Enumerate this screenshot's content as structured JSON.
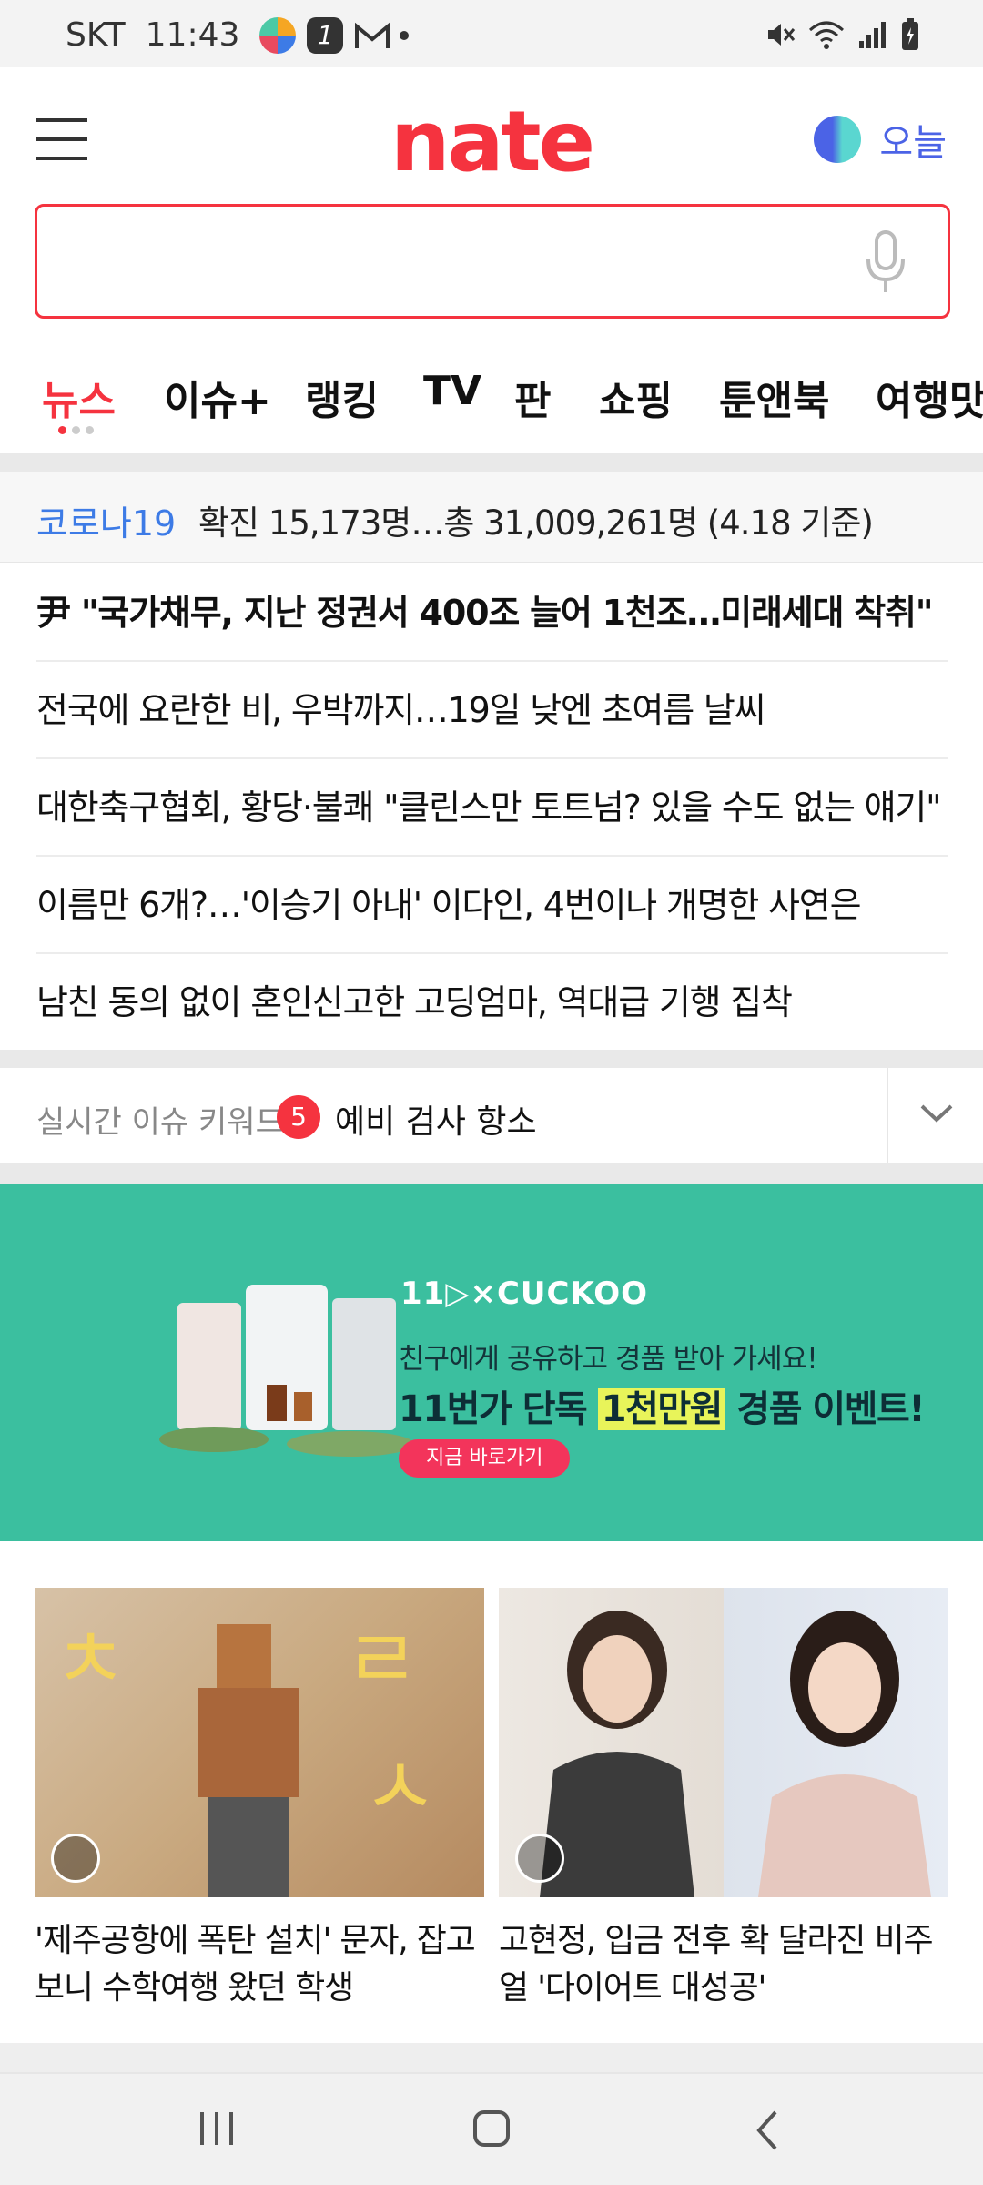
{
  "status_bar": {
    "carrier": "SKT",
    "time": "11:43"
  },
  "header": {
    "logo": "nate",
    "today_label": "오늘"
  },
  "search": {
    "value": "",
    "placeholder": ""
  },
  "tabs": [
    {
      "label": "뉴스"
    },
    {
      "label": "이슈+"
    },
    {
      "label": "랭킹"
    },
    {
      "label": "TV"
    },
    {
      "label": "판"
    },
    {
      "label": "쇼핑"
    },
    {
      "label": "툰앤북"
    },
    {
      "label": "여행맛"
    }
  ],
  "covid": {
    "label": "코로나19",
    "text": "확진 15,173명…총 31,009,261명 (4.18 기준)"
  },
  "headlines": [
    "尹 \"국가채무, 지난 정권서 400조 늘어 1천조…미래세대 착취\"",
    "전국에 요란한 비, 우박까지…19일 낮엔 초여름 날씨",
    "대한축구협회, 황당·불쾌 \"클린스만 토트넘? 있을 수도 없는 얘기\"",
    "이름만 6개?…'이승기 아내' 이다인, 4번이나 개명한 사연은",
    "남친 동의 없이 혼인신고한 고딩엄마, 역대급 기행 집착"
  ],
  "keyword": {
    "label": "실시간 이슈 키워드",
    "rank": "5",
    "text": "예비 검사 항소"
  },
  "ad": {
    "brand": "11▷×CUCKOO",
    "line1": "친구에게 공유하고 경품 받아 가세요!",
    "line2_pre": "11번가 단독",
    "line2_highlight": "1천만원",
    "line2_post": "경품 이벤트!",
    "cta": "지금 바로가기",
    "bg_color": "#3bbf9f"
  },
  "cards": [
    {
      "title": "'제주공항에 폭탄 설치' 문자, 잡고보니 수학여행 왔던 학생"
    },
    {
      "title": "고현정, 입금 전후 확 달라진 비주얼 '다이어트 대성공'"
    }
  ],
  "colors": {
    "accent": "#f5333f",
    "link_blue": "#3d7be6",
    "today_blue": "#4b63e6"
  }
}
